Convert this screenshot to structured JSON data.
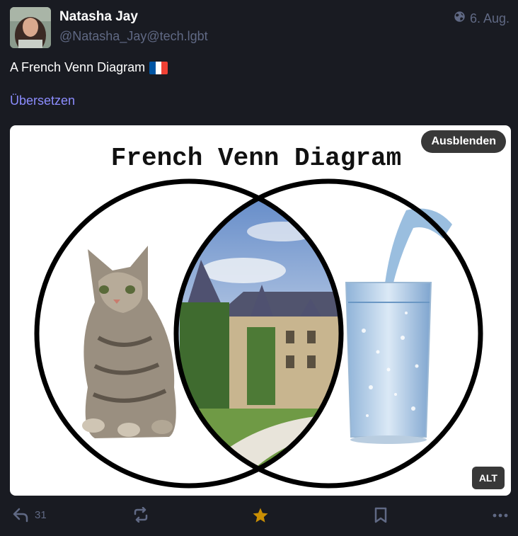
{
  "post": {
    "author": {
      "display_name": "Natasha Jay",
      "handle": "@Natasha_Jay@tech.lgbt"
    },
    "visibility_icon": "globe-icon",
    "date": "6. Aug.",
    "text": "A French Venn Diagram",
    "emoji": "flag-france",
    "translate_label": "Übersetzen"
  },
  "media": {
    "image_title": "French Venn Diagram",
    "hide_label": "Ausblenden",
    "alt_label": "ALT"
  },
  "actions": {
    "reply_count": "31",
    "icons": [
      "reply-icon",
      "boost-icon",
      "favourite-icon",
      "bookmark-icon",
      "more-icon"
    ]
  },
  "colors": {
    "background": "#191b22",
    "muted": "#606984",
    "link": "#8c8dff",
    "favourite": "#ca8f04",
    "flag_blue": "#0055a4",
    "flag_white": "#ffffff",
    "flag_red": "#ef4135"
  }
}
